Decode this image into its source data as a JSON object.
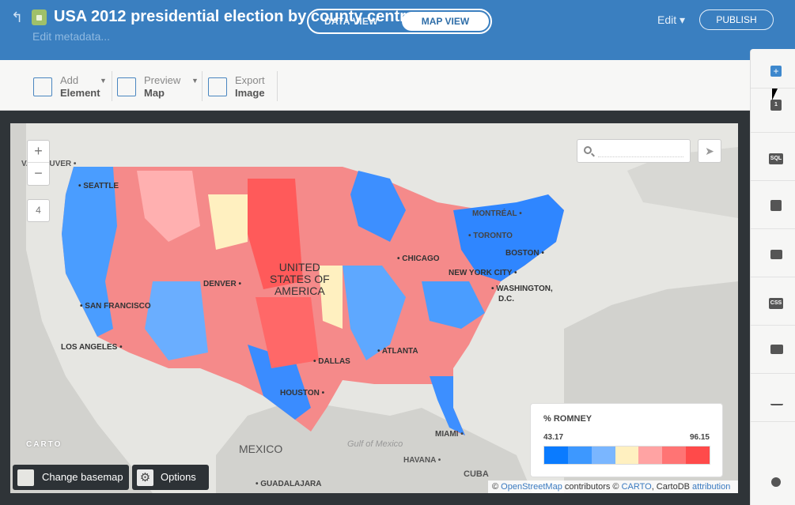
{
  "header": {
    "title": "USA 2012 presidential election by county centro...",
    "edit_metadata": "Edit metadata...",
    "data_view": "DATA VIEW",
    "map_view": "MAP VIEW",
    "edit": "Edit ▾",
    "publish": "PUBLISH",
    "colors": {
      "bar": "#3a7fc0"
    }
  },
  "toolbar": {
    "add": {
      "line1": "Add",
      "line2": "Element"
    },
    "preview": {
      "line1": "Preview",
      "line2": "Map"
    },
    "export": {
      "line1": "Export",
      "line2": "Image"
    }
  },
  "map": {
    "zoom_in": "+",
    "zoom_out": "−",
    "zoom_level": "4",
    "labels": {
      "vancouver": "VANCOUVER •",
      "seattle": "• SEATTLE",
      "montreal": "MONTRÉAL •",
      "toronto": "• TORONTO",
      "boston": "BOSTON •",
      "chicago": "• CHICAGO",
      "new_york": "NEW YORK CITY •",
      "washington": "• WASHINGTON,",
      "dc": "D.C.",
      "denver": "DENVER •",
      "usa1": "UNITED",
      "usa2": "STATES OF",
      "usa3": "AMERICA",
      "san_francisco": "• SAN FRANCISCO",
      "los_angeles": "LOS ANGELES •",
      "atlanta": "• ATLANTA",
      "dallas": "• DALLAS",
      "houston": "HOUSTON •",
      "miami": "MIAMI •",
      "gulf": "Gulf of Mexico",
      "mexico": "MEXICO",
      "havana": "HAVANA •",
      "cuba": "CUBA",
      "guadalajara": "• GUADALAJARA"
    },
    "search_placeholder": "",
    "change_basemap": "Change basemap",
    "options": "Options",
    "carto_logo": "CARTO",
    "attribution": {
      "copy1": "© ",
      "osm": "OpenStreetMap",
      "contrib": " contributors © ",
      "carto": "CARTO",
      "cartodb": ", CartoDB ",
      "attrib": "attribution"
    }
  },
  "legend": {
    "title": "% ROMNEY",
    "min": "43.17",
    "max": "96.15",
    "colors": [
      "#0a7bff",
      "#3d98ff",
      "#7ab6ff",
      "#fff0c0",
      "#ffa3a3",
      "#ff7474",
      "#ff4a4a"
    ]
  },
  "right_panel": {
    "layer_count": "1",
    "add_layer": "+",
    "items": [
      "SQL",
      "wizard",
      "infowindow",
      "CSS",
      "legends",
      "filters",
      "tooltip"
    ]
  }
}
